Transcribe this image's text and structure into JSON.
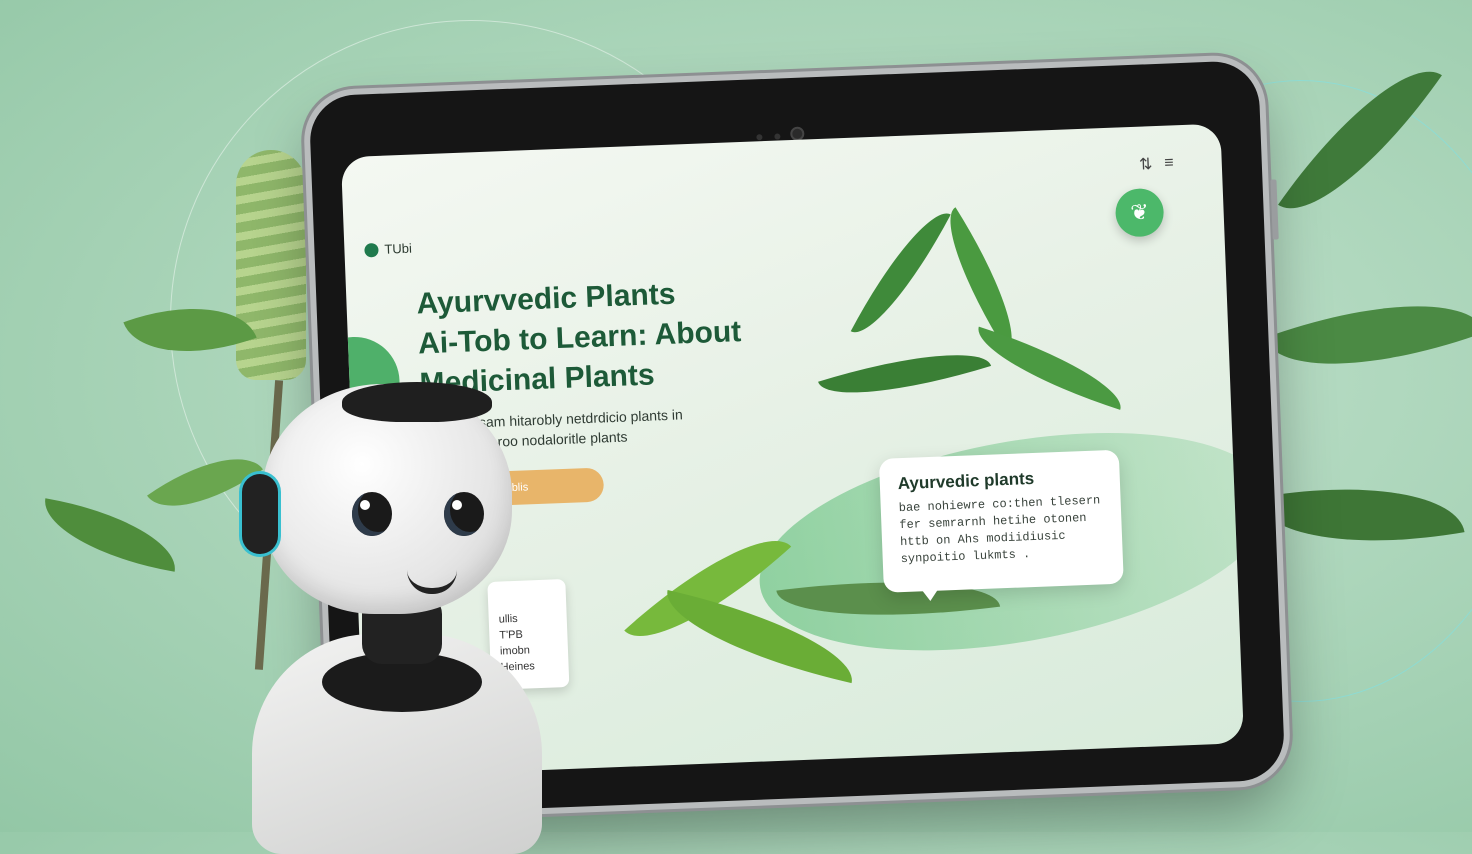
{
  "app": {
    "brand_name": "TUbi",
    "headline": [
      "Ayurvvedic Plants",
      "Ai-Tob to Learn: About",
      "Medicinal Plants"
    ],
    "intro": [
      "To lsam hitarobly netdrdicio plants in",
      "t:er beroo nodaloritle plants"
    ],
    "cta_label": "blis",
    "menu_glyph": "≡",
    "toggle_glyph": "⇅",
    "fab_icon": "leaf-icon"
  },
  "info_card": {
    "title": "Ayurvedic plants",
    "lines": [
      "bae nohiewre co:then tlesern",
      "fer semrarnh hetihe otonen",
      "httb on Ahs modiidiusic",
      "synpoitio lukmts ."
    ]
  },
  "side_card": {
    "lines": [
      "ullis",
      "T'PB",
      "imobn",
      "Heines"
    ]
  },
  "colors": {
    "accent": "#4cb86a",
    "headline": "#1d5a38",
    "cta": "#e8b56a",
    "background": "#a9d4b8"
  }
}
